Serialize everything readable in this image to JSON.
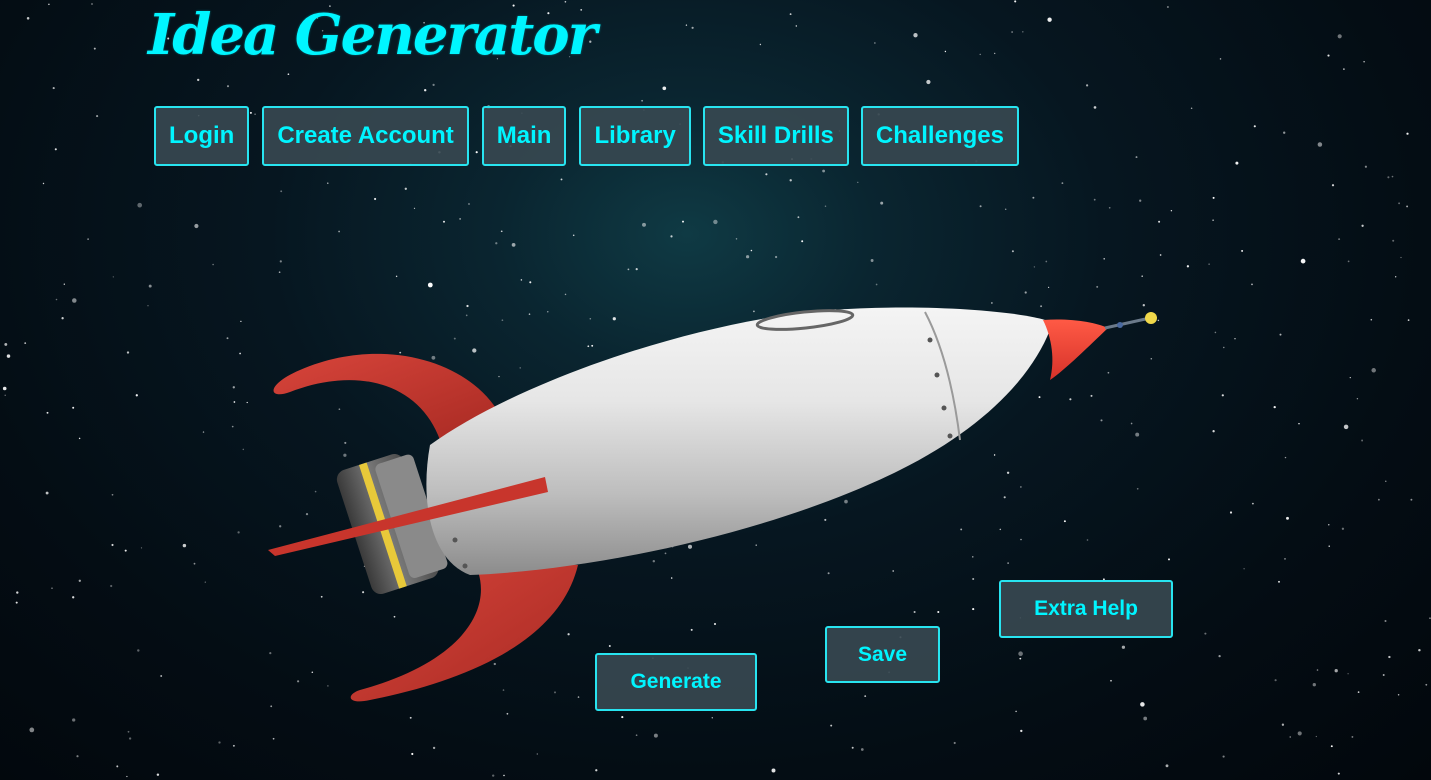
{
  "app": {
    "title": "Idea Generator"
  },
  "nav": {
    "items": [
      {
        "label": "Login"
      },
      {
        "label": "Create Account"
      },
      {
        "label": "Main"
      },
      {
        "label": "Library"
      },
      {
        "label": "Skill Drills"
      },
      {
        "label": "Challenges"
      }
    ]
  },
  "actions": {
    "generate_label": "Generate",
    "save_label": "Save",
    "extra_help_label": "Extra Help"
  },
  "theme": {
    "accent": "#00f5ff",
    "button_bg": "#374850",
    "rocket_body": "#d9d9d9",
    "rocket_fins": "#c0342c",
    "rocket_ring": "#e8c93a"
  },
  "background": {
    "icon": "space-starfield"
  },
  "illustration": {
    "icon": "rocket-icon"
  }
}
